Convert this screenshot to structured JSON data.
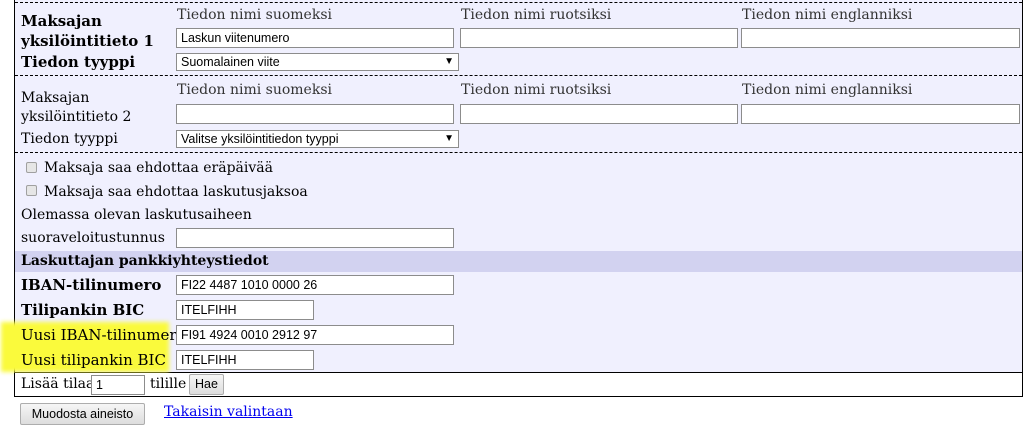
{
  "column_headers": {
    "fi": "Tiedon nimi suomeksi",
    "sv": "Tiedon nimi ruotsiksi",
    "en": "Tiedon nimi englanniksi"
  },
  "identifier1": {
    "label_line1": "Maksajan",
    "label_line2": "yksilöintitieto 1",
    "name_fi": "Laskun viitenumero",
    "name_sv": "",
    "name_en": "",
    "type_label": "Tiedon tyyppi",
    "type_value": "Suomalainen viite"
  },
  "identifier2": {
    "label_line1": "Maksajan",
    "label_line2": "yksilöintitieto 2",
    "name_fi": "",
    "name_sv": "",
    "name_en": "",
    "type_label": "Tiedon tyyppi",
    "type_value": "Valitse yksilöintitiedon tyyppi"
  },
  "options": {
    "due_date_label": "Maksaja saa ehdottaa eräpäivää",
    "billing_period_label": "Maksaja saa ehdottaa laskutusjaksoa",
    "due_date_checked": false,
    "billing_period_checked": false
  },
  "direct_debit": {
    "label_line1": "Olemassa olevan laskutusaiheen",
    "label_line2": "suoraveloitustunnus",
    "value": ""
  },
  "bank": {
    "section_title": "Laskuttajan pankkiyhteystiedot",
    "iban_label": "IBAN-tilinumero",
    "iban_value": "FI22 4487 1010 0000 26",
    "bic_label": "Tilipankin BIC",
    "bic_value": "ITELFIHH",
    "new_iban_label": "Uusi IBAN-tilinumero",
    "new_iban_value": "FI91 4924 0010 2912 97",
    "new_bic_label": "Uusi tilipankin BIC",
    "new_bic_value": "ITELFIHH"
  },
  "space": {
    "prefix": "Lisää tilaa",
    "value": "1",
    "suffix": "tilille",
    "button": "Hae"
  },
  "footer": {
    "create_button": "Muodosta aineisto",
    "back_link": "Takaisin valintaan"
  },
  "colors": {
    "form_background": "#f0f0fe",
    "section_bar": "#d2d2f0",
    "highlight": "#fafa3c",
    "link": "#0000ee"
  }
}
